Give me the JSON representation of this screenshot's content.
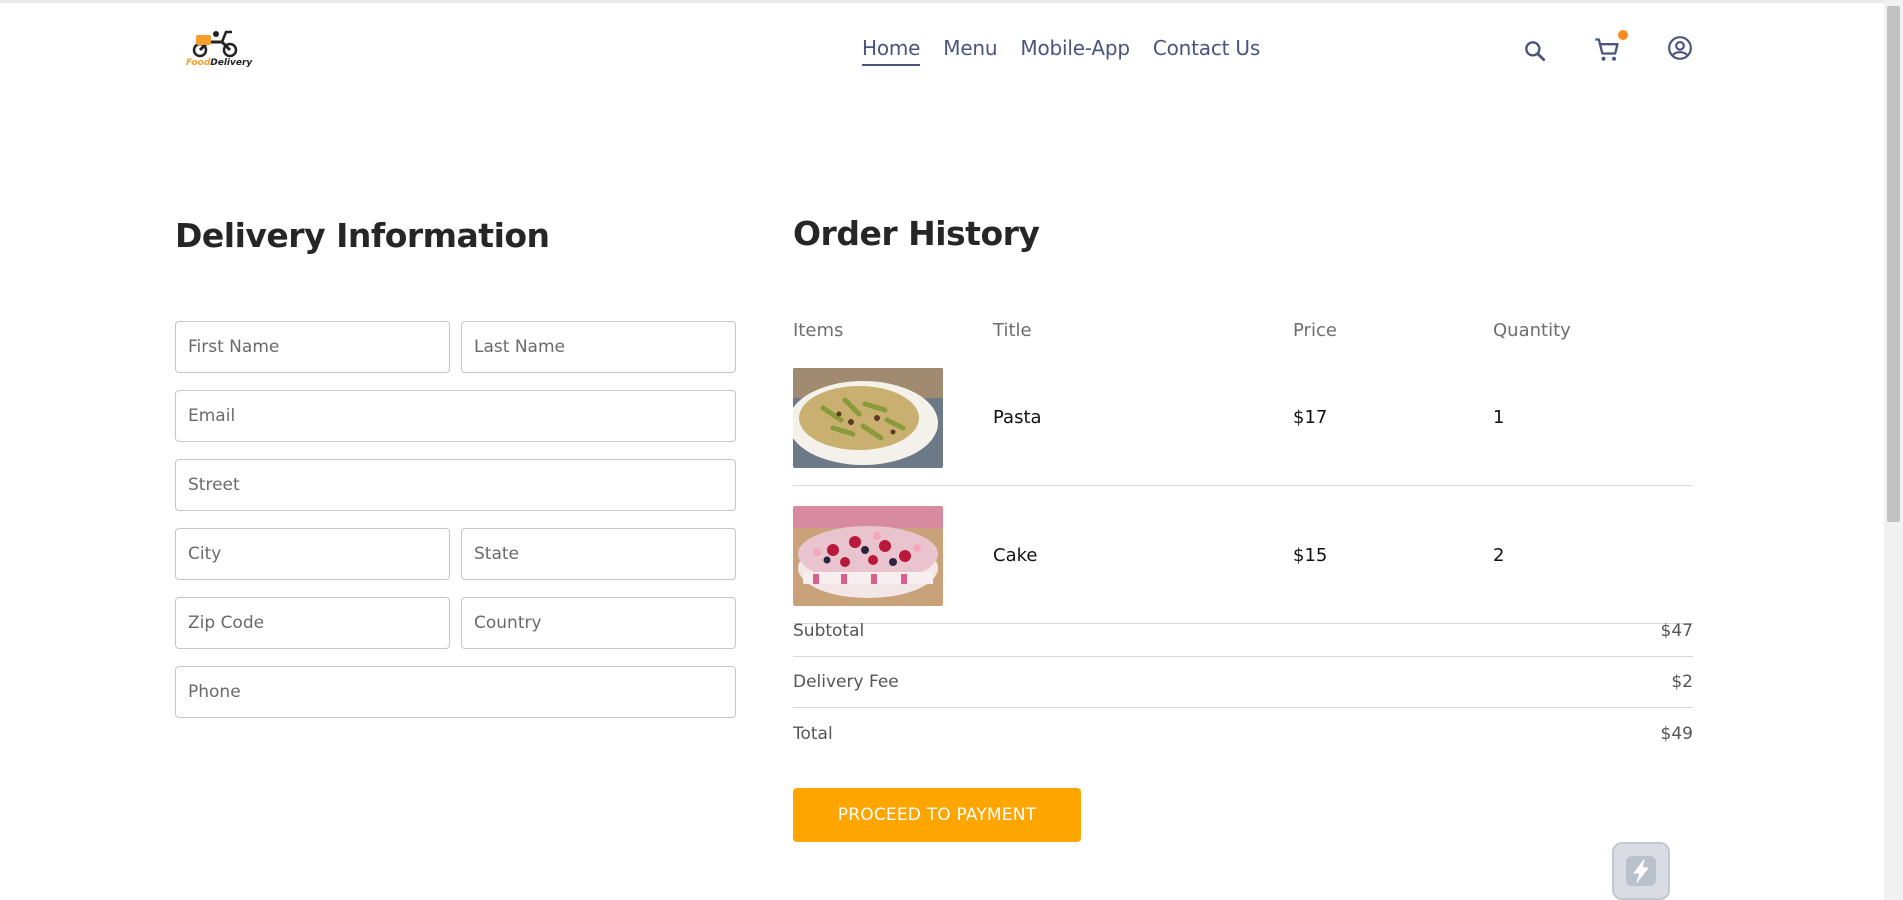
{
  "brand": {
    "logo_part1": "Food",
    "logo_part2": "Delivery"
  },
  "nav": {
    "links": [
      {
        "label": "Home",
        "active": true
      },
      {
        "label": "Menu",
        "active": false
      },
      {
        "label": "Mobile-App",
        "active": false
      },
      {
        "label": "Contact Us",
        "active": false
      }
    ],
    "icons": [
      "search-icon",
      "cart-icon",
      "profile-icon"
    ],
    "cart_badge_color": "#ff8a1f"
  },
  "delivery": {
    "title": "Delivery Information",
    "fields": {
      "first_name": "First Name",
      "last_name": "Last Name",
      "email": "Email",
      "street": "Street",
      "city": "City",
      "state": "State",
      "zip": "Zip Code",
      "country": "Country",
      "phone": "Phone"
    }
  },
  "order": {
    "title": "Order History",
    "headers": {
      "items": "Items",
      "title": "Title",
      "price": "Price",
      "quantity": "Quantity"
    },
    "rows": [
      {
        "image": "pasta-photo",
        "title": "Pasta",
        "price": "$17",
        "quantity": "1"
      },
      {
        "image": "cake-photo",
        "title": "Cake",
        "price": "$15",
        "quantity": "2"
      }
    ],
    "summary": {
      "subtotal_label": "Subtotal",
      "subtotal": "$47",
      "delivery_label": "Delivery Fee",
      "delivery": "$2",
      "total_label": "Total",
      "total": "$49"
    },
    "pay_button": "PROCEED TO PAYMENT"
  },
  "colors": {
    "accent": "#ffa500",
    "nav_text": "#49557e"
  }
}
